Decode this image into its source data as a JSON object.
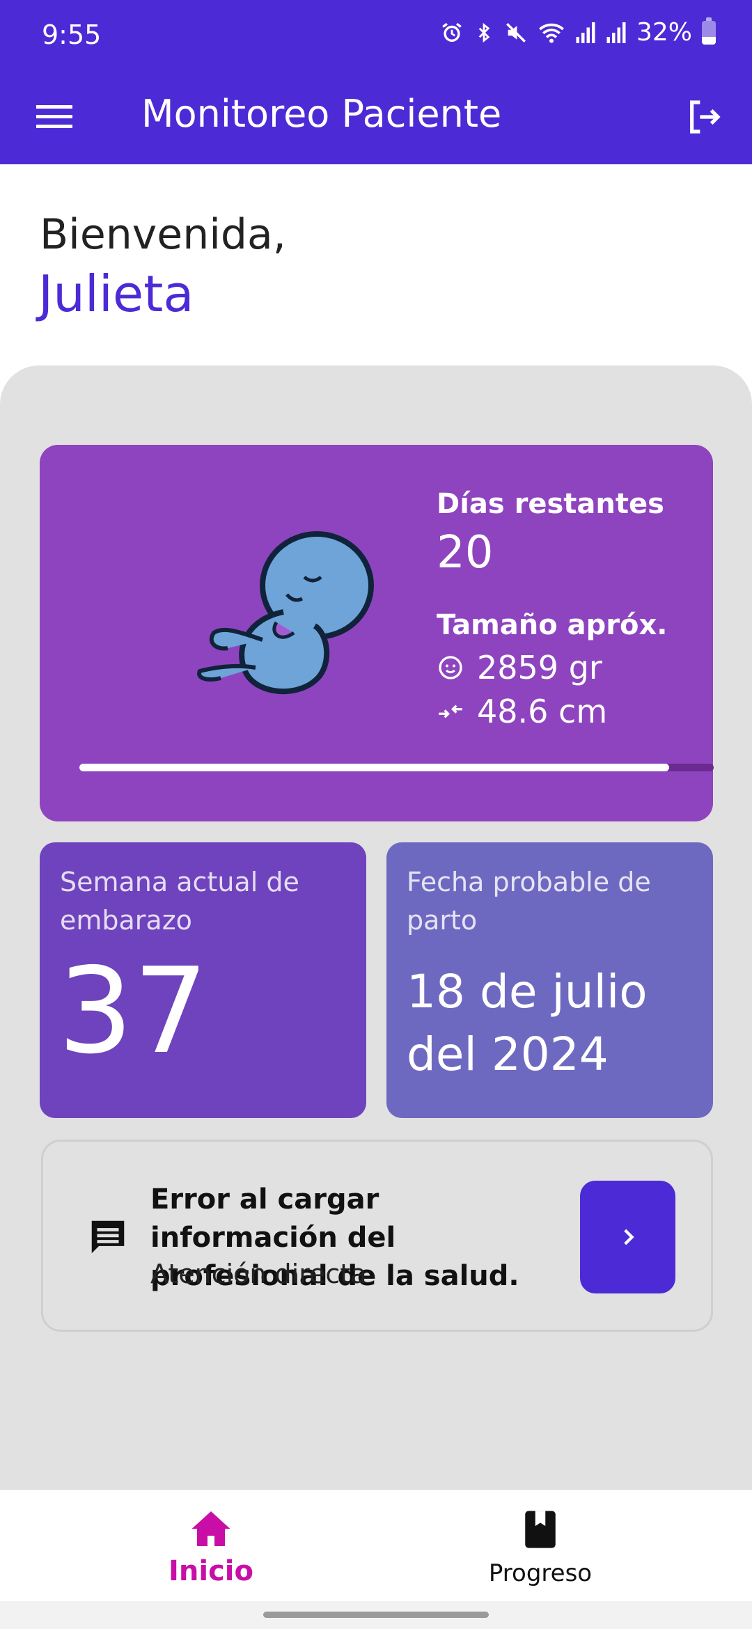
{
  "status_bar": {
    "time": "9:55",
    "battery": "32%",
    "icons": [
      "alarm-icon",
      "bluetooth-icon",
      "mute-icon",
      "wifi-icon",
      "signal-icon",
      "signal-icon",
      "battery-icon"
    ]
  },
  "app_bar": {
    "title": "Monitoreo Paciente",
    "menu_icon": "menu-icon",
    "logout_icon": "logout-icon",
    "color": "#4c2bd6"
  },
  "greeting": {
    "welcome": "Bienvenida,",
    "name": "Julieta"
  },
  "pregnancy_card": {
    "days_label": "Días restantes",
    "days_value": "20",
    "size_label": "Tamaño apróx.",
    "weight": "2859 gr",
    "length": "48.6 cm",
    "progress_fraction": 0.93,
    "color": "#8f44bf"
  },
  "week_card": {
    "label": "Semana actual de embarazo",
    "value": "37",
    "color": "#6e43bd"
  },
  "due_date_card": {
    "label": "Fecha probable de parto",
    "value": "18 de julio del 2024",
    "color": "#6e69c0"
  },
  "professional_card": {
    "title": "Error al cargar información del profesional de la salud.",
    "subtitle": "Atención directa",
    "icon": "message-icon",
    "action_icon": "chevron-right-icon"
  },
  "bottom_nav": {
    "items": [
      {
        "label": "Inicio",
        "icon": "home-icon",
        "active": true
      },
      {
        "label": "Progreso",
        "icon": "book-icon",
        "active": false
      }
    ],
    "active_color": "#c80ea6"
  }
}
